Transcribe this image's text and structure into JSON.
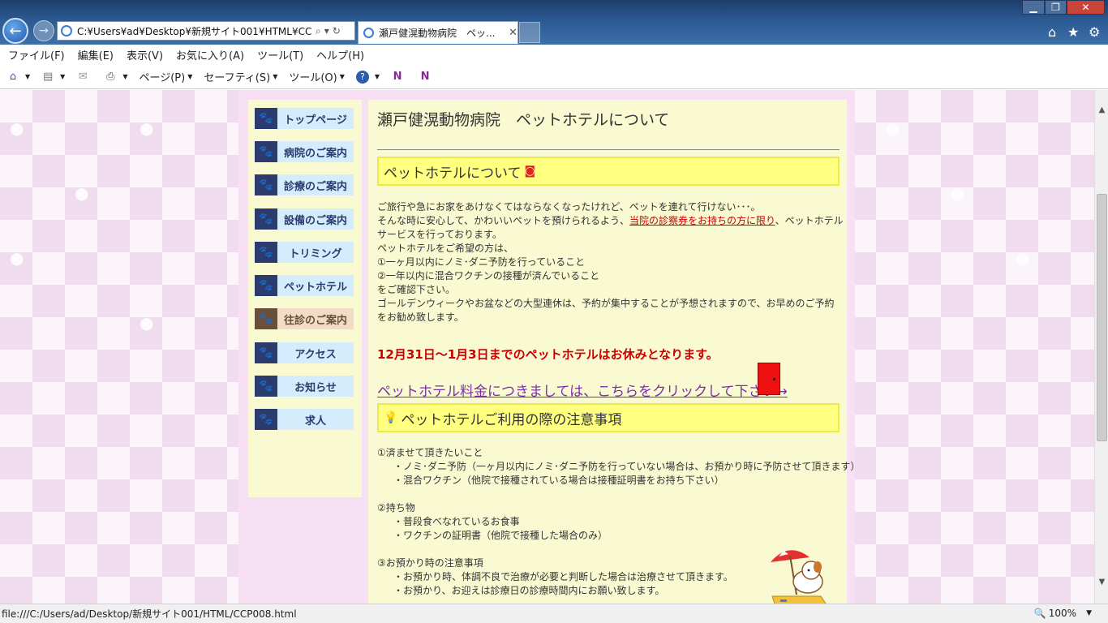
{
  "browser": {
    "address_url": "C:¥Users¥ad¥Desktop¥新規サイト001¥HTML¥CCP008.html",
    "tab_title": "瀬戸健滉動物病院　ペッ...",
    "menus": [
      "ファイル(F)",
      "編集(E)",
      "表示(V)",
      "お気に入り(A)",
      "ツール(T)",
      "ヘルプ(H)"
    ],
    "commands": {
      "page": "ページ(P)",
      "safety": "セーフティ(S)",
      "tools": "ツール(O)"
    },
    "status_url": "file:///C:/Users/ad/Desktop/新規サイト001/HTML/CCP008.html",
    "zoom": "100%"
  },
  "sidebar": {
    "items": [
      {
        "label": "トップページ",
        "active": false
      },
      {
        "label": "病院のご案内",
        "active": false
      },
      {
        "label": "診療のご案内",
        "active": false
      },
      {
        "label": "設備のご案内",
        "active": false
      },
      {
        "label": "トリミング",
        "active": false
      },
      {
        "label": "ペットホテル",
        "active": false
      },
      {
        "label": "往診のご案内",
        "active": true
      },
      {
        "label": "アクセス",
        "active": false
      },
      {
        "label": "お知らせ",
        "active": false
      },
      {
        "label": "求人",
        "active": false
      }
    ]
  },
  "content": {
    "page_title": "瀬戸健滉動物病院　ペットホテルについて",
    "section1_title": "ペットホテルについて",
    "intro": {
      "line1": "ご旅行や急にお家をあけなくてはならなくなったけれど、ペットを連れて行けない･･･。",
      "line2_before": "そんな時に安心して、かわいいペットを預けられるよう、",
      "line2_link": "当院の診察券をお持ちの方に限り",
      "line2_after": "、ペットホテルサービスを行っております。",
      "line3": "ペットホテルをご希望の方は、",
      "line4": "①一ヶ月以内にノミ･ダニ予防を行っていること",
      "line5": "②一年以内に混合ワクチンの接種が済んでいること",
      "line6": "をご確認下さい。",
      "line7": "ゴールデンウィークやお盆などの大型連休は、予約が集中することが予想されますので、お早めのご予約をお勧め致します。"
    },
    "closed_notice": "12月31日～1月3日までのペットホテルはお休みとなります。",
    "price_link": "ペットホテル料金につきましては、こちらをクリックして下さい→",
    "section2_title": "ペットホテルご利用の際の注意事項",
    "notes": {
      "n1_title": "①済ませて頂きたいこと",
      "n1_a": "・ノミ･ダニ予防（一ヶ月以内にノミ･ダニ予防を行っていない場合は、お預かり時に予防させて頂きます）",
      "n1_b": "・混合ワクチン（他院で接種されている場合は接種証明書をお持ち下さい）",
      "n2_title": "②持ち物",
      "n2_a": "・普段食べなれているお食事",
      "n2_b": "・ワクチンの証明書（他院で接種した場合のみ）",
      "n3_title": "③お預かり時の注意事項",
      "n3_a": "・お預かり時、体調不良で治療が必要と判断した場合は治療させて頂きます。",
      "n3_b": "・お預かり、お迎えは診療日の診療時間内にお願い致します。"
    }
  },
  "colors": {
    "sidebar_bg": "#fafad2",
    "nav_button": "#d4ecfb",
    "nav_active": "#f2dcc8",
    "section_head": "#ffff80",
    "notice_red": "#cc0000",
    "link_purple": "#7a2fa8"
  }
}
